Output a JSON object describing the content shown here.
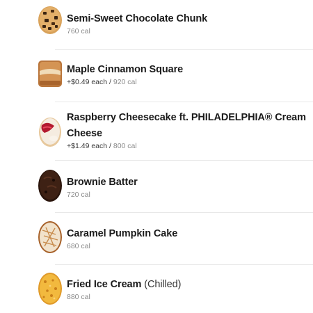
{
  "items": [
    {
      "name": "Semi-Sweet Chocolate Chunk",
      "price": "",
      "cal": "760 cal",
      "icon": "chocolate-chunk-cookie-icon"
    },
    {
      "name": "Maple Cinnamon Square",
      "price": "+$0.49 each / ",
      "cal": "920 cal",
      "icon": "maple-square-icon"
    },
    {
      "name": "Raspberry Cheesecake ft. PHILADELPHIA® Cream Cheese",
      "price": "+$1.49 each / ",
      "cal": "800 cal",
      "icon": "cheesecake-cookie-icon"
    },
    {
      "name": "Brownie Batter",
      "price": "",
      "cal": "720 cal",
      "icon": "brownie-cookie-icon"
    },
    {
      "name": "Caramel Pumpkin Cake",
      "price": "",
      "cal": "680 cal",
      "icon": "pumpkin-cake-cookie-icon"
    },
    {
      "name": "Fried Ice Cream",
      "note": "(Chilled)",
      "price": "",
      "cal": "880 cal",
      "icon": "fried-ice-cream-cookie-icon"
    }
  ],
  "colors": {
    "text": "#1b1b1b",
    "meta": "#8a8a8a",
    "divider": "#e8e8e8"
  }
}
